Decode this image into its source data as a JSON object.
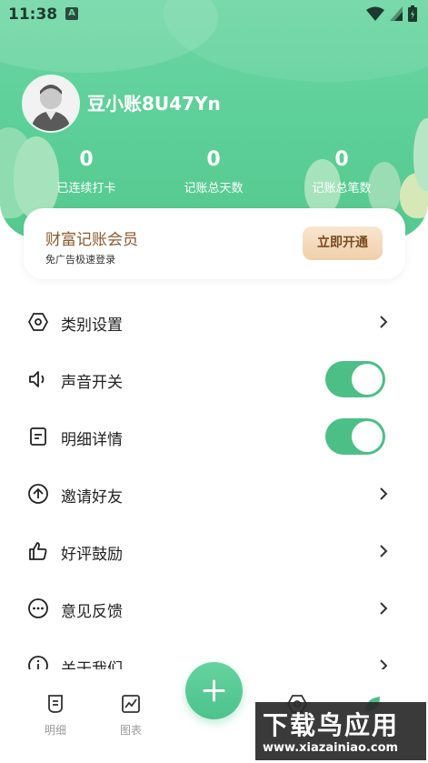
{
  "status_bar": {
    "time": "11:38",
    "notification_icon": "A"
  },
  "profile": {
    "username": "豆小账8U47Yn"
  },
  "stats": [
    {
      "value": "0",
      "label": "已连续打卡"
    },
    {
      "value": "0",
      "label": "记账总天数"
    },
    {
      "value": "0",
      "label": "记账总笔数"
    }
  ],
  "vip_card": {
    "title": "财富记账会员",
    "subtitle": "免广告极速登录",
    "button_label": "立即开通"
  },
  "menu": [
    {
      "label": "类别设置",
      "icon": "hexagon-settings-icon",
      "control": "chevron"
    },
    {
      "label": "声音开关",
      "icon": "speaker-icon",
      "control": "toggle",
      "on": true
    },
    {
      "label": "明细详情",
      "icon": "document-icon",
      "control": "toggle",
      "on": true
    },
    {
      "label": "邀请好友",
      "icon": "upload-circle-icon",
      "control": "chevron"
    },
    {
      "label": "好评鼓励",
      "icon": "thumbs-up-icon",
      "control": "chevron"
    },
    {
      "label": "意见反馈",
      "icon": "chat-dots-icon",
      "control": "chevron"
    },
    {
      "label": "关于我们",
      "icon": "info-icon",
      "control": "chevron"
    }
  ],
  "tabbar": {
    "items": [
      {
        "label": "明细",
        "icon": "receipt-icon"
      },
      {
        "label": "图表",
        "icon": "chart-icon"
      }
    ],
    "fab_label": "+"
  },
  "watermark": {
    "title": "下载鸟应用",
    "url": "www.xiazainiao.com"
  },
  "colors": {
    "primary": "#5ccf98",
    "toggle_on": "#4cbf87",
    "vip_text": "#8a5a2e"
  }
}
